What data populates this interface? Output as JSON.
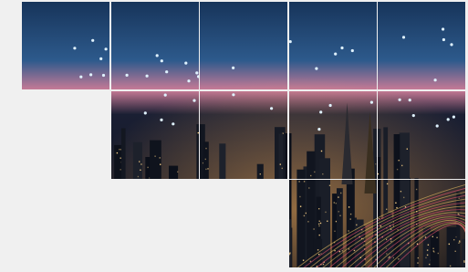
{
  "scene": {
    "description": "",
    "sky_top_color": "#17345a",
    "sky_mid_color": "#2d5a8c",
    "horizon_color": "#c77a96",
    "city_dark_color": "#0b0f1a",
    "light_line_color": "#dff2ff"
  },
  "grid": {
    "columns": 5,
    "rows": 3,
    "tile_map": [
      [
        1,
        1,
        1,
        1,
        1
      ],
      [
        0,
        1,
        1,
        1,
        1
      ],
      [
        0,
        0,
        0,
        1,
        1
      ]
    ]
  }
}
